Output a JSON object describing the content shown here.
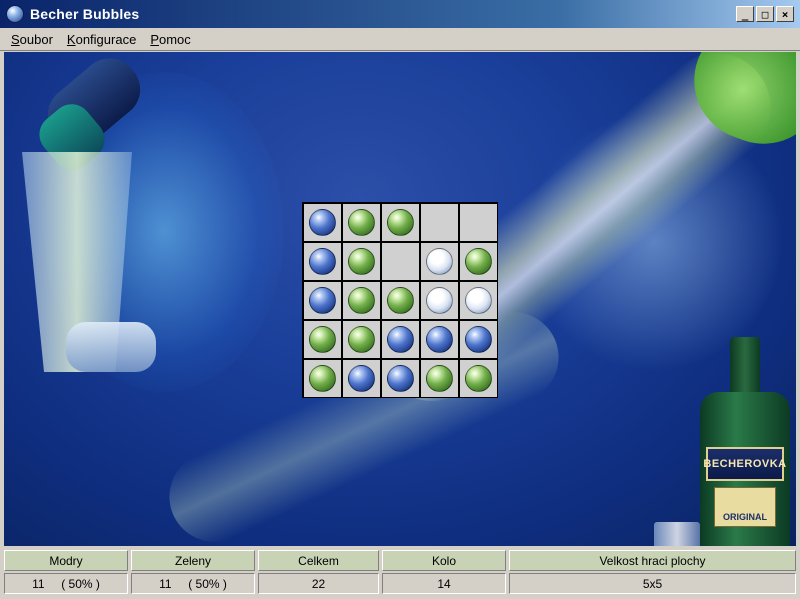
{
  "window": {
    "title": "Becher Bubbles",
    "buttons": {
      "minimize": "_",
      "maximize": "□",
      "close": "×"
    }
  },
  "menu": [
    {
      "accel": "S",
      "rest": "oubor"
    },
    {
      "accel": "K",
      "rest": "onfigurace"
    },
    {
      "accel": "P",
      "rest": "omoc"
    }
  ],
  "scene": {
    "bottle_label": "BECHEROVKA",
    "bottle_sublabel": "ORIGINAL"
  },
  "board": {
    "size": 5,
    "grid": [
      [
        "blue",
        "green",
        "green",
        "empty",
        "empty"
      ],
      [
        "blue",
        "green",
        "empty",
        "white",
        "green"
      ],
      [
        "blue",
        "green",
        "green",
        "white",
        "white"
      ],
      [
        "green",
        "green",
        "blue",
        "blue",
        "blue"
      ],
      [
        "green",
        "blue",
        "blue",
        "green",
        "green"
      ]
    ],
    "colors": {
      "blue": "#4d74cc",
      "green": "#72ae4a",
      "white": "#ffffff",
      "cell": "#d0d0d0"
    }
  },
  "status": {
    "headers": [
      "Modry",
      "Zeleny",
      "Celkem",
      "Kolo",
      "Velkost hraci plochy"
    ],
    "values": [
      "11     ( 50% )",
      "11     ( 50% )",
      "22",
      "14",
      "5x5"
    ]
  }
}
